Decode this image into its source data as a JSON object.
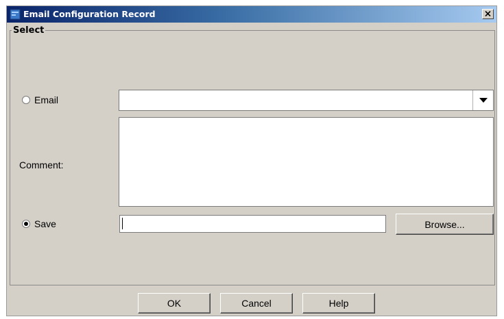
{
  "window": {
    "title": "Email Configuration Record",
    "close_icon": "close-icon"
  },
  "group": {
    "legend": "Select"
  },
  "email": {
    "label": "Email",
    "selected": false,
    "value": ""
  },
  "comment": {
    "label": "Comment:",
    "value": ""
  },
  "save": {
    "label": "Save",
    "selected": true,
    "value": "",
    "browse_label": "Browse..."
  },
  "buttons": {
    "ok": "OK",
    "cancel": "Cancel",
    "help": "Help"
  }
}
